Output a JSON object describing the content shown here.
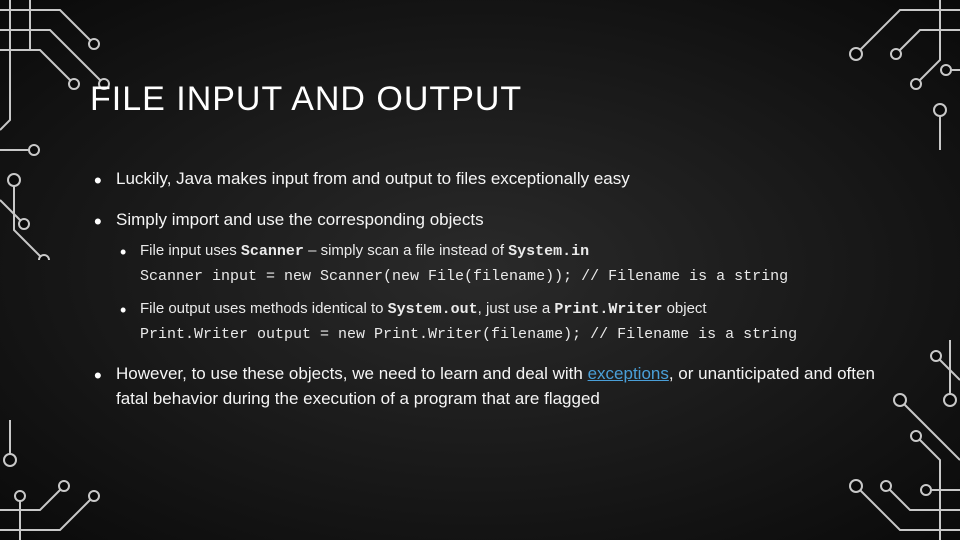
{
  "title": "FILE INPUT AND OUTPUT",
  "bullets": {
    "b1": "Luckily, Java makes input from and output to files exceptionally easy",
    "b2": "Simply import and use the corresponding objects",
    "b2a_pre": "File input uses ",
    "b2a_scanner": "Scanner",
    "b2a_mid": " – simply scan a file instead of ",
    "b2a_sysin": "System.in",
    "b2a_code": "Scanner input = new Scanner(new File(filename)); // Filename is a string",
    "b2b_pre": "File output uses methods identical to ",
    "b2b_sysout": "System.out",
    "b2b_mid": ", just use a ",
    "b2b_pw": "Print.Writer",
    "b2b_post": " object",
    "b2b_code": "Print.Writer output = new Print.Writer(filename); // Filename is a string",
    "b3_pre": "However, to use these objects, we need to learn and deal with ",
    "b3_link": "exceptions",
    "b3_post": ", or unanticipated and often fatal behavior during the execution of a program that are flagged"
  }
}
